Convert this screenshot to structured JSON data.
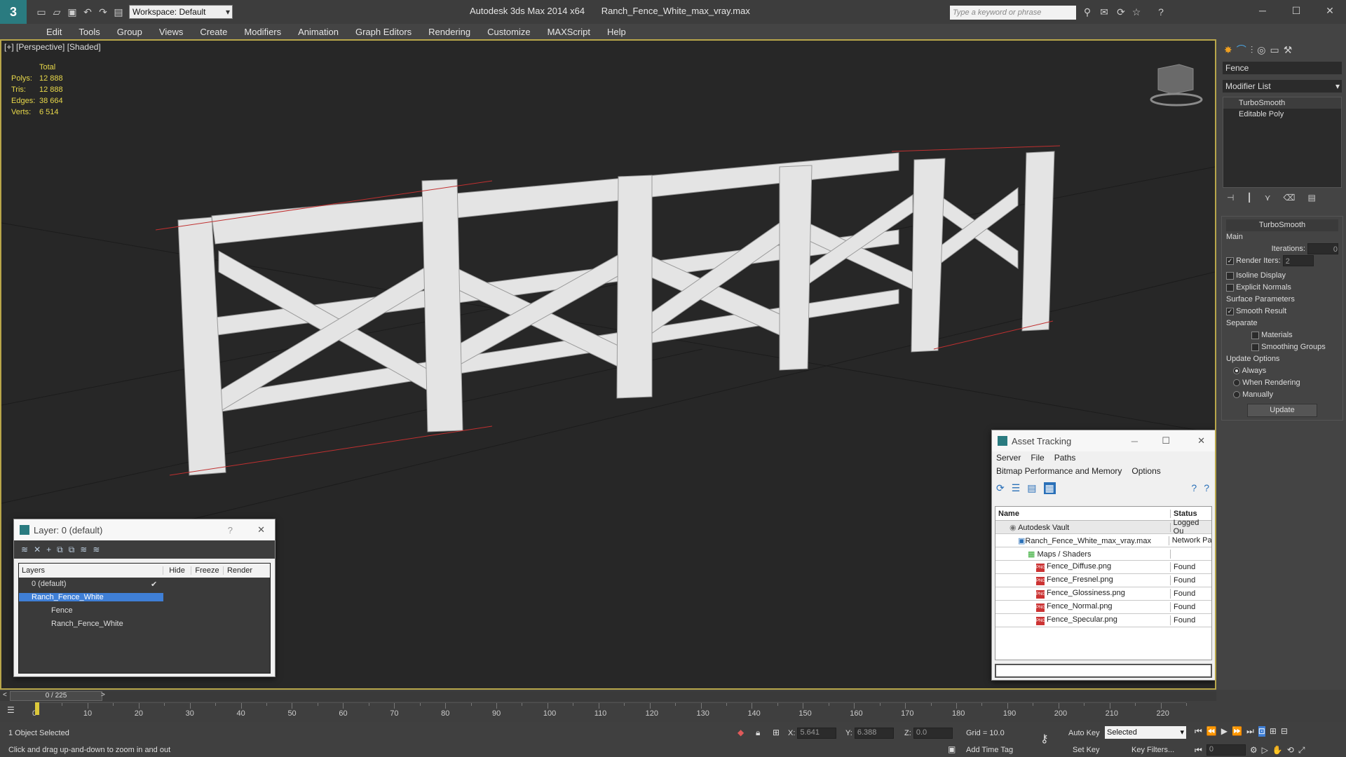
{
  "titlebar": {
    "workspace": "Workspace: Default",
    "app": "Autodesk 3ds Max  2014 x64",
    "file": "Ranch_Fence_White_max_vray.max",
    "search_placeholder": "Type a keyword or phrase"
  },
  "menus": [
    "Edit",
    "Tools",
    "Group",
    "Views",
    "Create",
    "Modifiers",
    "Animation",
    "Graph Editors",
    "Rendering",
    "Customize",
    "MAXScript",
    "Help"
  ],
  "viewport": {
    "label": "[+] [Perspective] [Shaded]",
    "stats": {
      "header": "Total",
      "rows": [
        {
          "k": "Polys:",
          "v": "12 888"
        },
        {
          "k": "Tris:",
          "v": "12 888"
        },
        {
          "k": "Edges:",
          "v": "38 664"
        },
        {
          "k": "Verts:",
          "v": "6 514"
        }
      ]
    }
  },
  "cmd": {
    "object_name": "Fence",
    "modifier_list": "Modifier List",
    "stack": [
      "TurboSmooth",
      "Editable Poly"
    ],
    "rollout": "TurboSmooth",
    "main": "Main",
    "iterations_label": "Iterations:",
    "iterations": "0",
    "render_iters_label": "Render Iters:",
    "render_iters": "2",
    "isoline": "Isoline Display",
    "explicit": "Explicit Normals",
    "surface": "Surface Parameters",
    "smooth_result": "Smooth Result",
    "separate": "Separate",
    "materials": "Materials",
    "smoothing": "Smoothing Groups",
    "update_opts": "Update Options",
    "always": "Always",
    "when_rendering": "When Rendering",
    "manually": "Manually",
    "update": "Update"
  },
  "layer": {
    "title": "Layer: 0 (default)",
    "headers": [
      "Layers",
      "Hide",
      "Freeze",
      "Render"
    ],
    "rows": [
      {
        "name": "0 (default)",
        "level": 0
      },
      {
        "name": "Ranch_Fence_White",
        "level": 0,
        "selected": true
      },
      {
        "name": "Fence",
        "level": 1
      },
      {
        "name": "Ranch_Fence_White",
        "level": 1
      }
    ]
  },
  "asset": {
    "title": "Asset Tracking",
    "menu1": [
      "Server",
      "File",
      "Paths"
    ],
    "menu2": [
      "Bitmap Performance and Memory",
      "Options"
    ],
    "headers": [
      "Name",
      "Status"
    ],
    "rows": [
      {
        "name": "Autodesk Vault",
        "status": "Logged Ou",
        "level": 0
      },
      {
        "name": "Ranch_Fence_White_max_vray.max",
        "status": "Network Pa",
        "level": 1
      },
      {
        "name": "Maps / Shaders",
        "status": "",
        "level": 2
      },
      {
        "name": "Fence_Diffuse.png",
        "status": "Found",
        "level": 3
      },
      {
        "name": "Fence_Fresnel.png",
        "status": "Found",
        "level": 3
      },
      {
        "name": "Fence_Glossiness.png",
        "status": "Found",
        "level": 3
      },
      {
        "name": "Fence_Normal.png",
        "status": "Found",
        "level": 3
      },
      {
        "name": "Fence_Specular.png",
        "status": "Found",
        "level": 3
      }
    ]
  },
  "timeline": {
    "frame": "0 / 225",
    "ticks": [
      "0",
      "10",
      "20",
      "30",
      "40",
      "50",
      "60",
      "70",
      "80",
      "90",
      "100",
      "110",
      "120",
      "130",
      "140",
      "150",
      "160",
      "170",
      "180",
      "190",
      "200",
      "210",
      "220"
    ]
  },
  "status": {
    "selected": "1 Object Selected",
    "prompt": "Click and drag up-and-down to zoom in and out",
    "x": "5.641",
    "y": "6.388",
    "z": "0.0",
    "grid": "Grid = 10.0",
    "addtime": "Add Time Tag",
    "autokey": "Auto Key",
    "setkey": "Set Key",
    "sel_mode": "Selected",
    "keyfilters": "Key Filters...",
    "frame_field": "0"
  }
}
